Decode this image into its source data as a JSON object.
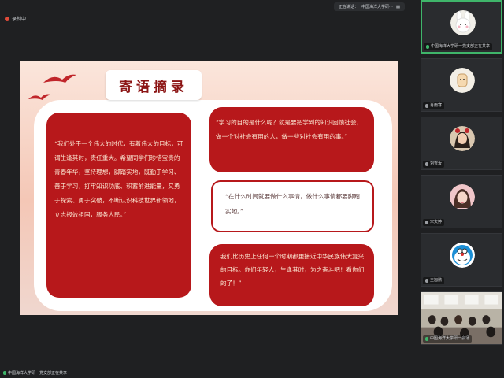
{
  "top_bar": {
    "recording_label": "录制中",
    "presenter_prefix": "正在讲话：",
    "presenter_name": "中国海洋大学研···"
  },
  "slide": {
    "title": "寄语摘录",
    "left_quote": "“我们处于一个伟大的时代，有着伟大的目标，可谓生逢其时，责任重大。希望同学们珍惜宝贵的青春年华，坚持理想，脚踏实地，既勤于学习、善于学习，打牢知识功底、积蓄前进能量，又勇于探索、勇于突破，不断认识科技世界新领地，立志报效祖国，服务人民。”",
    "top_right_quote": "“学习的目的是什么呢？就是要把学到的知识回馈社会，做一个对社会有用的人，做一些对社会有用的事。”",
    "mid_right_quote": "“在什么时间就要做什么事情，做什么事情都要脚踏实地。”",
    "bottom_right_quote": "我们比历史上任何一个时期都更接近中华民族伟大复兴的目标。你们年轻人，生逢其时，为之奋斗吧！看你们的了！”"
  },
  "participants": [
    {
      "name": "中国海洋大学研一党支部正在共享",
      "avatar_icon": "rabbit-avatar-icon",
      "mic": "on"
    },
    {
      "name": "肖雨寒",
      "avatar_icon": "cartoon-avatar-icon",
      "mic": "off"
    },
    {
      "name": "刘雪汝",
      "avatar_icon": "girl-photo-avatar-icon",
      "mic": "off"
    },
    {
      "name": "宋文婷",
      "avatar_icon": "girl-photo-avatar-icon",
      "mic": "off"
    },
    {
      "name": "王旭鹏",
      "avatar_icon": "doraemon-avatar-icon",
      "mic": "off"
    },
    {
      "name": "中国海洋大学研一会场",
      "avatar_icon": "classroom-video-icon",
      "mic": "on"
    }
  ],
  "bottom_bar": {
    "sharing_label": "中国海洋大学研一党支部正在共享"
  },
  "colors": {
    "slide_red": "#b7181b",
    "active_border": "#3fb56a",
    "background": "#1f2022"
  }
}
